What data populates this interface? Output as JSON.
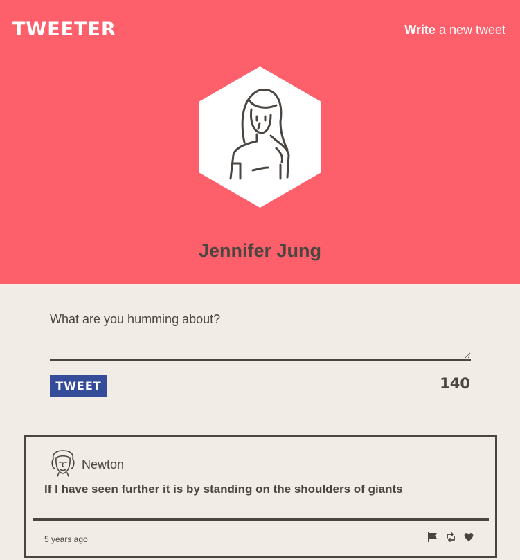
{
  "header": {
    "logo": "TWEETER",
    "write_bold": "Write",
    "write_rest": " a new tweet"
  },
  "profile": {
    "name": "Jennifer Jung",
    "avatar_icon": "woman-avatar-icon"
  },
  "compose": {
    "placeholder": "What are you humming about?",
    "value": "",
    "tweet_label": "TWEET",
    "char_count": "140"
  },
  "tweets": [
    {
      "user": "Newton",
      "avatar_icon": "newton-avatar-icon",
      "text": "If I have seen further it is by standing on the shoulders of giants",
      "time": "5 years ago",
      "actions": [
        "flag-icon",
        "retweet-icon",
        "heart-icon"
      ]
    }
  ],
  "colors": {
    "header_bg": "#fd5f6b",
    "page_bg": "#f1ede6",
    "text": "#4a4540",
    "button_bg": "#344c9a"
  }
}
